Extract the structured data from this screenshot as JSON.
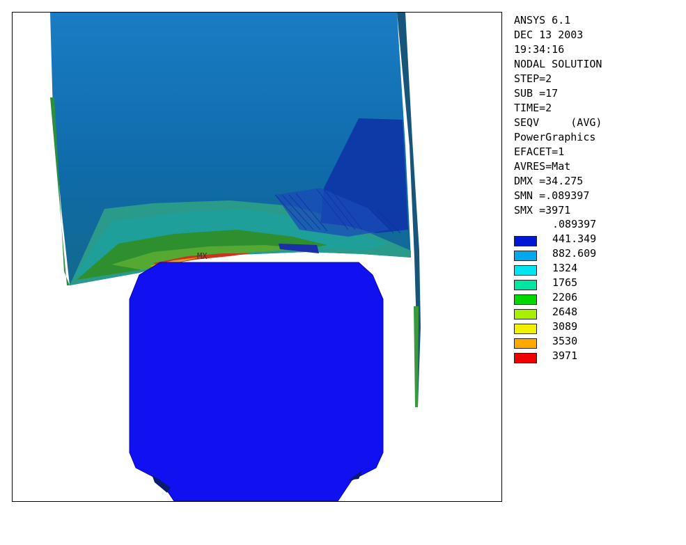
{
  "header_lines": [
    "ANSYS 6.1",
    "DEC 13 2003",
    "19:34:16",
    "NODAL SOLUTION",
    "STEP=2",
    "SUB =17",
    "TIME=2",
    "SEQV     (AVG)",
    "PowerGraphics",
    "EFACET=1",
    "AVRES=Mat",
    "DMX =34.275",
    "SMN =.089397",
    "SMX =3971"
  ],
  "legend": [
    {
      "value": ".089397",
      "color": ""
    },
    {
      "value": "441.349",
      "color": "#0018d6"
    },
    {
      "value": "882.609",
      "color": "#00a8f0"
    },
    {
      "value": "1324",
      "color": "#00e6f0"
    },
    {
      "value": "1765",
      "color": "#00e6a0"
    },
    {
      "value": "2206",
      "color": "#00d800"
    },
    {
      "value": "2648",
      "color": "#a8f000"
    },
    {
      "value": "3089",
      "color": "#f0f000"
    },
    {
      "value": "3530",
      "color": "#ffa800"
    },
    {
      "value": "3971",
      "color": "#f00000"
    }
  ],
  "max_marker": "MX"
}
